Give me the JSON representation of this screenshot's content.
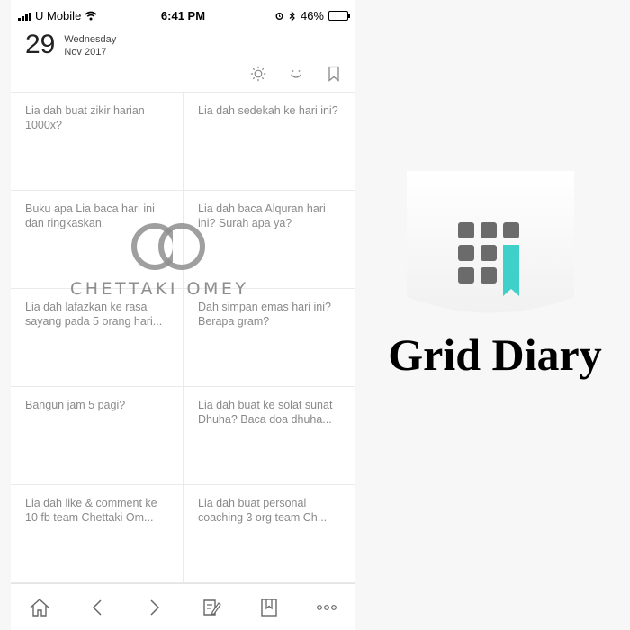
{
  "status_bar": {
    "carrier": "U Mobile",
    "time": "6:41 PM",
    "battery": "46%",
    "battery_level": 0.46
  },
  "header": {
    "day": "29",
    "weekday": "Wednesday",
    "month_year": "Nov 2017",
    "icons": [
      "sun-icon",
      "smile-icon",
      "bookmark-icon"
    ]
  },
  "grid": {
    "cells": [
      "Lia dah buat zikir harian 1000x?",
      "Lia dah sedekah ke hari ini?",
      "Buku apa Lia baca hari ini dan ringkaskan.",
      "Lia dah baca Alquran hari ini? Surah apa ya?",
      "Lia dah lafazkan ke rasa sayang pada 5 orang hari...",
      "Dah simpan emas hari ini? Berapa gram?",
      "Bangun jam 5 pagi?",
      "Lia dah buat ke solat sunat Dhuha? Baca doa dhuha...",
      "Lia dah like & comment ke 10 fb team Chettaki Om...",
      "Lia dah buat personal coaching 3 org team Ch..."
    ]
  },
  "watermark": {
    "text": "CHETTAKI OMEY"
  },
  "bottom_bar": {
    "icons": [
      "home-icon",
      "back-icon",
      "forward-icon",
      "edit-icon",
      "bookmark-icon",
      "more-icon"
    ]
  },
  "brand": {
    "title": "Grid Diary",
    "accent_color": "#3fd0c9",
    "tile_color": "#6b6b6b"
  }
}
